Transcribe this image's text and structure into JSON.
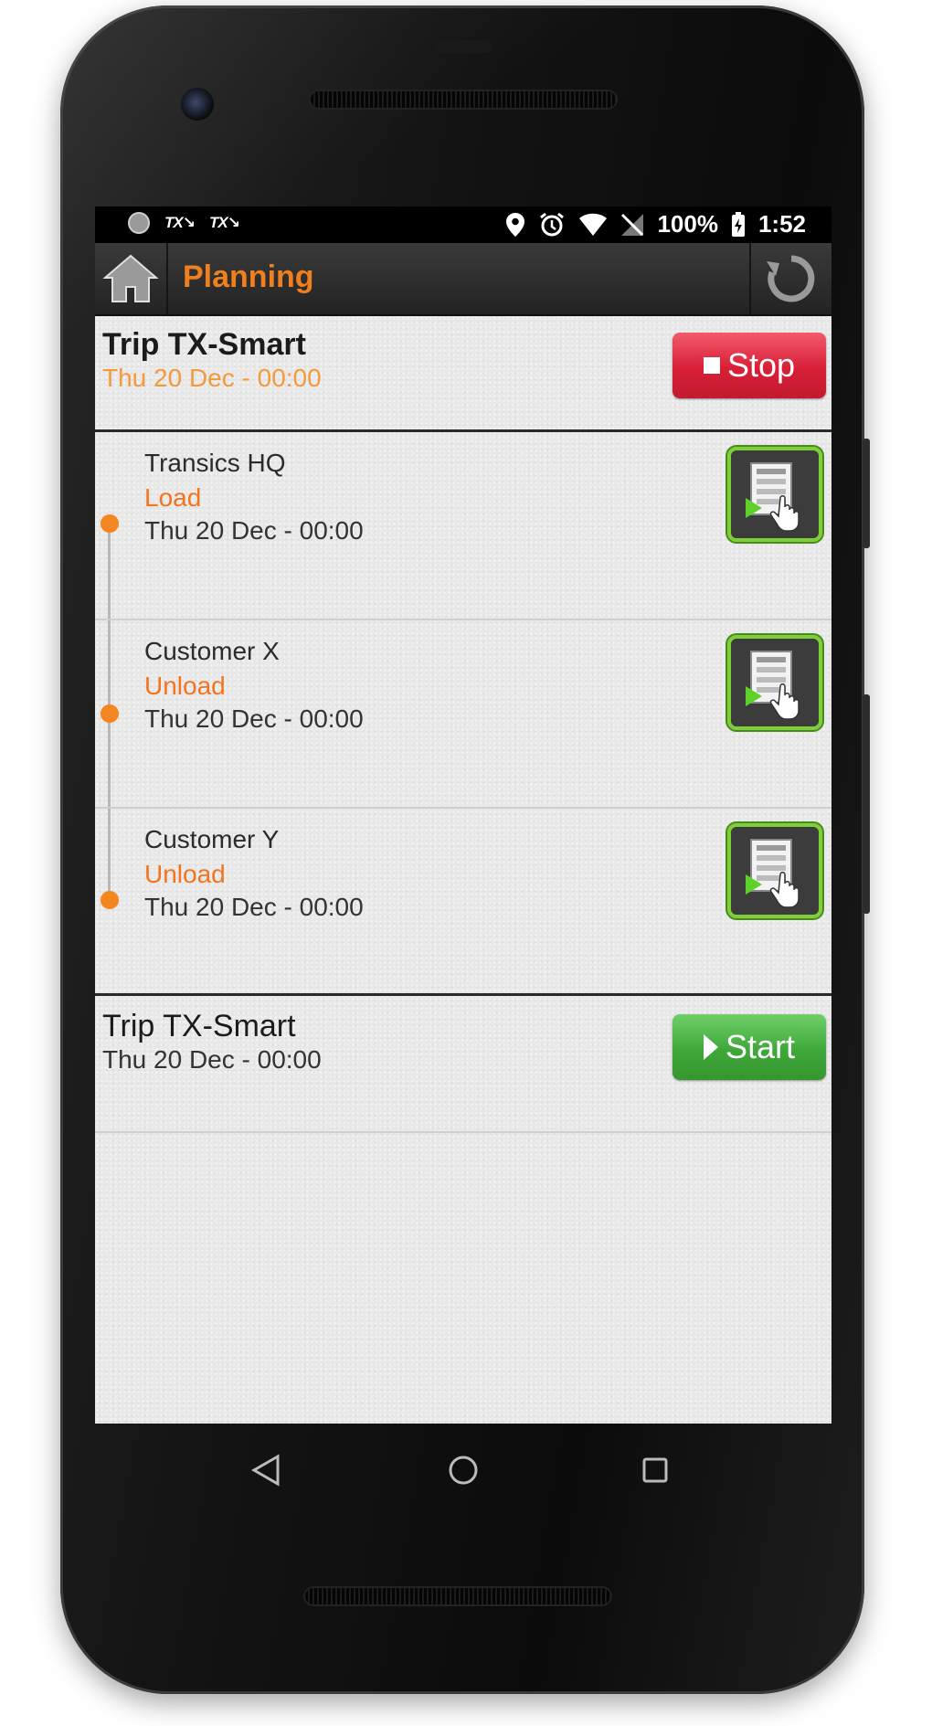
{
  "status_bar": {
    "battery": "100%",
    "time": "1:52",
    "notification_icons": [
      "circle-icon",
      "tx-icon",
      "tx-icon"
    ],
    "system_icons": [
      "location-icon",
      "alarm-icon",
      "wifi-icon",
      "no-signal-icon",
      "battery-charging-icon"
    ],
    "tx_label": "TX"
  },
  "appbar": {
    "title": "Planning",
    "title_color": "#f07f1e"
  },
  "trips": [
    {
      "title": "Trip TX-Smart",
      "date": "Thu 20 Dec - 00:00",
      "button_label": "Stop",
      "active": true,
      "stops": [
        {
          "name": "Transics HQ",
          "action": "Load",
          "date": "Thu 20 Dec - 00:00"
        },
        {
          "name": "Customer X",
          "action": "Unload",
          "date": "Thu 20 Dec - 00:00"
        },
        {
          "name": "Customer Y",
          "action": "Unload",
          "date": "Thu 20 Dec - 00:00"
        }
      ]
    },
    {
      "title": "Trip TX-Smart",
      "date": "Thu 20 Dec - 00:00",
      "button_label": "Start",
      "active": false
    }
  ],
  "colors": {
    "accent_orange": "#f3741e",
    "stop_red": "#d81f37",
    "start_green": "#3fa83a",
    "task_border_green": "#7fcf3a"
  },
  "navigation": [
    "back-icon",
    "home-icon",
    "recents-icon"
  ]
}
